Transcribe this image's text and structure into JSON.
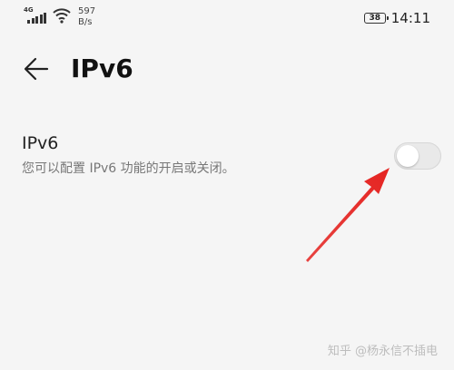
{
  "status_bar": {
    "network_type": "4G",
    "net_speed_value": "597",
    "net_speed_unit": "B/s",
    "battery_level": "38",
    "time": "14:11",
    "icons": [
      "cellular-signal-icon",
      "wifi-icon",
      "battery-icon"
    ]
  },
  "header": {
    "back_icon": "back-arrow-icon",
    "title": "IPv6"
  },
  "setting": {
    "title": "IPv6",
    "description": "您可以配置 IPv6 功能的开启或关闭。",
    "toggle_state": "off"
  },
  "annotation": {
    "arrow_color": "#e52421"
  },
  "watermark": {
    "text": "知乎 @杨永信不插电"
  }
}
